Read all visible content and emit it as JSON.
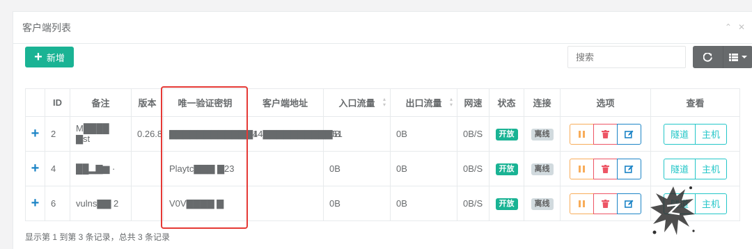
{
  "panel": {
    "title": "客户端列表"
  },
  "toolbar": {
    "add_label": "新增",
    "search_placeholder": "搜索"
  },
  "table": {
    "headers": {
      "id": "ID",
      "remark": "备注",
      "version": "版本",
      "verify_key": "唯一验证密钥",
      "client_addr": "客户端地址",
      "in_flow": "入口流量",
      "out_flow": "出口流量",
      "speed": "网速",
      "status": "状态",
      "connection": "连接",
      "options": "选项",
      "view": "查看"
    },
    "rows": [
      {
        "expand": "+",
        "id": "2",
        "remark": "M████ ▇st",
        "version": "0.26.8",
        "verify_key": "▇▇▇▇▇▇▇▇▇▇▇▇4",
        "client_addr": "14▇▇▇▇▇▇▇▇▇▇51",
        "in_flow": "0B",
        "out_flow": "0B",
        "speed": "0B/S",
        "status": "开放",
        "connection": "离线",
        "tunnel_label": "隧道",
        "host_label": "主机"
      },
      {
        "expand": "+",
        "id": "4",
        "remark": "██▂▇▆ ·",
        "version": "",
        "verify_key": "Playtc▇▇▇ ▇23",
        "client_addr": "",
        "in_flow": "0B",
        "out_flow": "0B",
        "speed": "0B/S",
        "status": "开放",
        "connection": "离线",
        "tunnel_label": "隧道",
        "host_label": "主机"
      },
      {
        "expand": "+",
        "id": "6",
        "remark": "vulns▇▇ 2",
        "version": "",
        "verify_key": "V0V▇▇▇▇ ▇",
        "client_addr": "",
        "in_flow": "0B",
        "out_flow": "0B",
        "speed": "0B/S",
        "status": "开放",
        "connection": "离线",
        "tunnel_label": "隧道",
        "host_label": "主机"
      }
    ]
  },
  "footer": {
    "summary": "显示第 1 到第 3 条记录，总共 3 条记录"
  },
  "colors": {
    "primary": "#1ab394",
    "info": "#1c84c6",
    "warning": "#f8ac59",
    "danger": "#ed5565",
    "cyan": "#23c6c8",
    "highlight": "#e53935"
  }
}
